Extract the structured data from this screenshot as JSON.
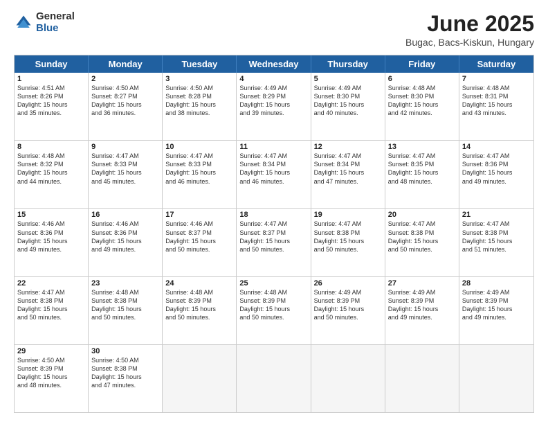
{
  "logo": {
    "general": "General",
    "blue": "Blue"
  },
  "title": "June 2025",
  "subtitle": "Bugac, Bacs-Kiskun, Hungary",
  "header_days": [
    "Sunday",
    "Monday",
    "Tuesday",
    "Wednesday",
    "Thursday",
    "Friday",
    "Saturday"
  ],
  "weeks": [
    [
      {
        "day": "1",
        "info": "Sunrise: 4:51 AM\nSunset: 8:26 PM\nDaylight: 15 hours\nand 35 minutes."
      },
      {
        "day": "2",
        "info": "Sunrise: 4:50 AM\nSunset: 8:27 PM\nDaylight: 15 hours\nand 36 minutes."
      },
      {
        "day": "3",
        "info": "Sunrise: 4:50 AM\nSunset: 8:28 PM\nDaylight: 15 hours\nand 38 minutes."
      },
      {
        "day": "4",
        "info": "Sunrise: 4:49 AM\nSunset: 8:29 PM\nDaylight: 15 hours\nand 39 minutes."
      },
      {
        "day": "5",
        "info": "Sunrise: 4:49 AM\nSunset: 8:30 PM\nDaylight: 15 hours\nand 40 minutes."
      },
      {
        "day": "6",
        "info": "Sunrise: 4:48 AM\nSunset: 8:30 PM\nDaylight: 15 hours\nand 42 minutes."
      },
      {
        "day": "7",
        "info": "Sunrise: 4:48 AM\nSunset: 8:31 PM\nDaylight: 15 hours\nand 43 minutes."
      }
    ],
    [
      {
        "day": "8",
        "info": "Sunrise: 4:48 AM\nSunset: 8:32 PM\nDaylight: 15 hours\nand 44 minutes."
      },
      {
        "day": "9",
        "info": "Sunrise: 4:47 AM\nSunset: 8:33 PM\nDaylight: 15 hours\nand 45 minutes."
      },
      {
        "day": "10",
        "info": "Sunrise: 4:47 AM\nSunset: 8:33 PM\nDaylight: 15 hours\nand 46 minutes."
      },
      {
        "day": "11",
        "info": "Sunrise: 4:47 AM\nSunset: 8:34 PM\nDaylight: 15 hours\nand 46 minutes."
      },
      {
        "day": "12",
        "info": "Sunrise: 4:47 AM\nSunset: 8:34 PM\nDaylight: 15 hours\nand 47 minutes."
      },
      {
        "day": "13",
        "info": "Sunrise: 4:47 AM\nSunset: 8:35 PM\nDaylight: 15 hours\nand 48 minutes."
      },
      {
        "day": "14",
        "info": "Sunrise: 4:47 AM\nSunset: 8:36 PM\nDaylight: 15 hours\nand 49 minutes."
      }
    ],
    [
      {
        "day": "15",
        "info": "Sunrise: 4:46 AM\nSunset: 8:36 PM\nDaylight: 15 hours\nand 49 minutes."
      },
      {
        "day": "16",
        "info": "Sunrise: 4:46 AM\nSunset: 8:36 PM\nDaylight: 15 hours\nand 49 minutes."
      },
      {
        "day": "17",
        "info": "Sunrise: 4:46 AM\nSunset: 8:37 PM\nDaylight: 15 hours\nand 50 minutes."
      },
      {
        "day": "18",
        "info": "Sunrise: 4:47 AM\nSunset: 8:37 PM\nDaylight: 15 hours\nand 50 minutes."
      },
      {
        "day": "19",
        "info": "Sunrise: 4:47 AM\nSunset: 8:38 PM\nDaylight: 15 hours\nand 50 minutes."
      },
      {
        "day": "20",
        "info": "Sunrise: 4:47 AM\nSunset: 8:38 PM\nDaylight: 15 hours\nand 50 minutes."
      },
      {
        "day": "21",
        "info": "Sunrise: 4:47 AM\nSunset: 8:38 PM\nDaylight: 15 hours\nand 51 minutes."
      }
    ],
    [
      {
        "day": "22",
        "info": "Sunrise: 4:47 AM\nSunset: 8:38 PM\nDaylight: 15 hours\nand 50 minutes."
      },
      {
        "day": "23",
        "info": "Sunrise: 4:48 AM\nSunset: 8:38 PM\nDaylight: 15 hours\nand 50 minutes."
      },
      {
        "day": "24",
        "info": "Sunrise: 4:48 AM\nSunset: 8:39 PM\nDaylight: 15 hours\nand 50 minutes."
      },
      {
        "day": "25",
        "info": "Sunrise: 4:48 AM\nSunset: 8:39 PM\nDaylight: 15 hours\nand 50 minutes."
      },
      {
        "day": "26",
        "info": "Sunrise: 4:49 AM\nSunset: 8:39 PM\nDaylight: 15 hours\nand 50 minutes."
      },
      {
        "day": "27",
        "info": "Sunrise: 4:49 AM\nSunset: 8:39 PM\nDaylight: 15 hours\nand 49 minutes."
      },
      {
        "day": "28",
        "info": "Sunrise: 4:49 AM\nSunset: 8:39 PM\nDaylight: 15 hours\nand 49 minutes."
      }
    ],
    [
      {
        "day": "29",
        "info": "Sunrise: 4:50 AM\nSunset: 8:39 PM\nDaylight: 15 hours\nand 48 minutes."
      },
      {
        "day": "30",
        "info": "Sunrise: 4:50 AM\nSunset: 8:38 PM\nDaylight: 15 hours\nand 47 minutes."
      },
      {
        "day": "",
        "info": ""
      },
      {
        "day": "",
        "info": ""
      },
      {
        "day": "",
        "info": ""
      },
      {
        "day": "",
        "info": ""
      },
      {
        "day": "",
        "info": ""
      }
    ]
  ]
}
